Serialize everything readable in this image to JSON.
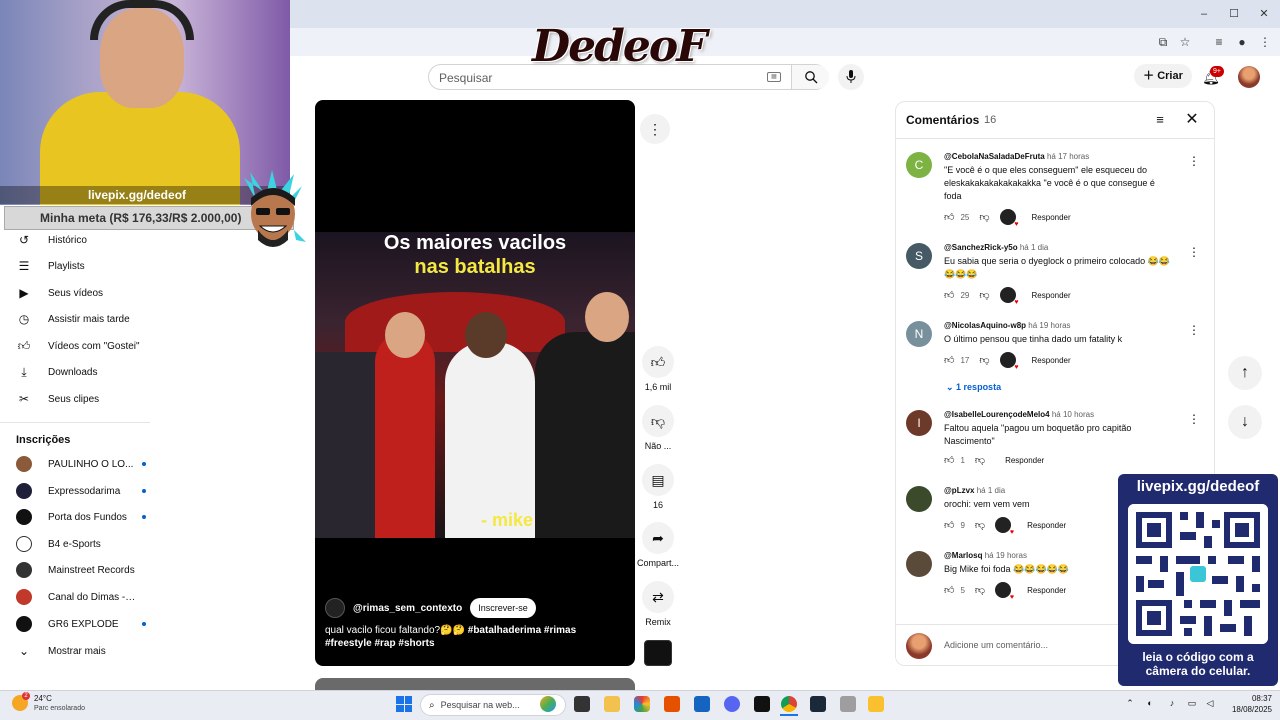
{
  "window": {
    "minimize": "‒",
    "maximize": "☐",
    "close": "✕"
  },
  "logo": {
    "text": "DedeoF"
  },
  "header": {
    "search_placeholder": "Pesquisar",
    "create_label": "Criar",
    "notifications_badge": "9+"
  },
  "webcam": {
    "livepix": "livepix.gg/dedeof",
    "meta": "Minha meta (R$ 176,33/R$ 2.000,00)"
  },
  "sidebar": {
    "items": [
      {
        "label": "Histórico",
        "icon": "history-icon"
      },
      {
        "label": "Playlists",
        "icon": "playlists-icon"
      },
      {
        "label": "Seus vídeos",
        "icon": "your-videos-icon"
      },
      {
        "label": "Assistir mais tarde",
        "icon": "watch-later-icon"
      },
      {
        "label": "Vídeos com \"Gostei\"",
        "icon": "liked-icon"
      },
      {
        "label": "Downloads",
        "icon": "download-icon"
      },
      {
        "label": "Seus clipes",
        "icon": "clips-icon"
      }
    ],
    "subscriptions_title": "Inscrições",
    "subscriptions": [
      {
        "label": "PAULINHO O LO...",
        "color": "#8a5a3a",
        "dot": true
      },
      {
        "label": "Expressodarima",
        "color": "#1f1f3a",
        "dot": true
      },
      {
        "label": "Porta dos Fundos",
        "color": "#111111",
        "dot": true
      },
      {
        "label": "B4 e-Sports",
        "color": "#ffffff",
        "dot": false
      },
      {
        "label": "Mainstreet Records",
        "color": "#333333",
        "dot": false
      },
      {
        "label": "Canal do Dimas - M...",
        "color": "#c0392b",
        "dot": false
      },
      {
        "label": "GR6 EXPLODE",
        "color": "#111111",
        "dot": true
      }
    ],
    "show_more": "Mostrar mais"
  },
  "short": {
    "title_line1": "Os maiores vacilos",
    "title_line2": "nas batalhas",
    "caption": "- mike",
    "channel": "@rimas_sem_contexto",
    "subscribe": "Inscrever-se",
    "description_plain": "qual vacilo ficou faltando?🤔🤔",
    "description_tags": "#batalhaderima #rimas #freestyle #rap #shorts"
  },
  "actions": {
    "like_count": "1,6 mil",
    "dislike_label": "Não ...",
    "comments_count": "16",
    "share_label": "Compart...",
    "remix_label": "Remix"
  },
  "comments": {
    "title": "Comentários",
    "count": "16",
    "add_placeholder": "Adicione um comentário...",
    "reply_label": "Responder",
    "items": [
      {
        "initial": "C",
        "color": "#7cb342",
        "author": "@CebolaNaSaladaDeFruta",
        "time": "há 17 horas",
        "text": "\"E você é o que eles conseguem\" ele esqueceu do eleskakakakakakakakka \"e você é o que consegue é foda",
        "likes": "25",
        "heart": true
      },
      {
        "initial": "S",
        "color": "#455a64",
        "author": "@SanchezRick-y5o",
        "time": "há 1 dia",
        "text": "Eu sabia que seria o dyeglock o primeiro colocado 😂😂😂😂😂",
        "likes": "29",
        "heart": true
      },
      {
        "initial": "N",
        "color": "#78909c",
        "author": "@NicolasAquino-w8p",
        "time": "há 19 horas",
        "text": "O último pensou que tinha dado um fatality k",
        "likes": "17",
        "heart": true
      },
      {
        "initial": "I",
        "color": "#6d3a2a",
        "author": "@IsabelleLourençodeMelo4",
        "time": "há 10 horas",
        "text": "Faltou aquela \"pagou um boquetão pro capitão Nascimento\"",
        "likes": "1",
        "heart": false
      },
      {
        "initial": "",
        "color": "#3a4a2a",
        "author": "@pLzvx",
        "time": "há 1 dia",
        "text": "orochi: vem vem vem",
        "likes": "9",
        "heart": true
      },
      {
        "initial": "",
        "color": "#5a4a3a",
        "author": "@Marlosq",
        "time": "há 19 horas",
        "text": "Big Mike foi foda 😂😂😂😂😂",
        "likes": "5",
        "heart": true
      }
    ],
    "replies_link": "1 resposta"
  },
  "qr": {
    "top": "livepix.gg/dedeof",
    "bottom_line1": "leia o código com a",
    "bottom_line2": "câmera do celular."
  },
  "taskbar": {
    "weather_temp": "24°C",
    "weather_desc": "Parc ensolarado",
    "weather_badge": "2",
    "search_placeholder": "Pesquisar na web...",
    "time": "08:37",
    "date": "18/08/2025"
  }
}
